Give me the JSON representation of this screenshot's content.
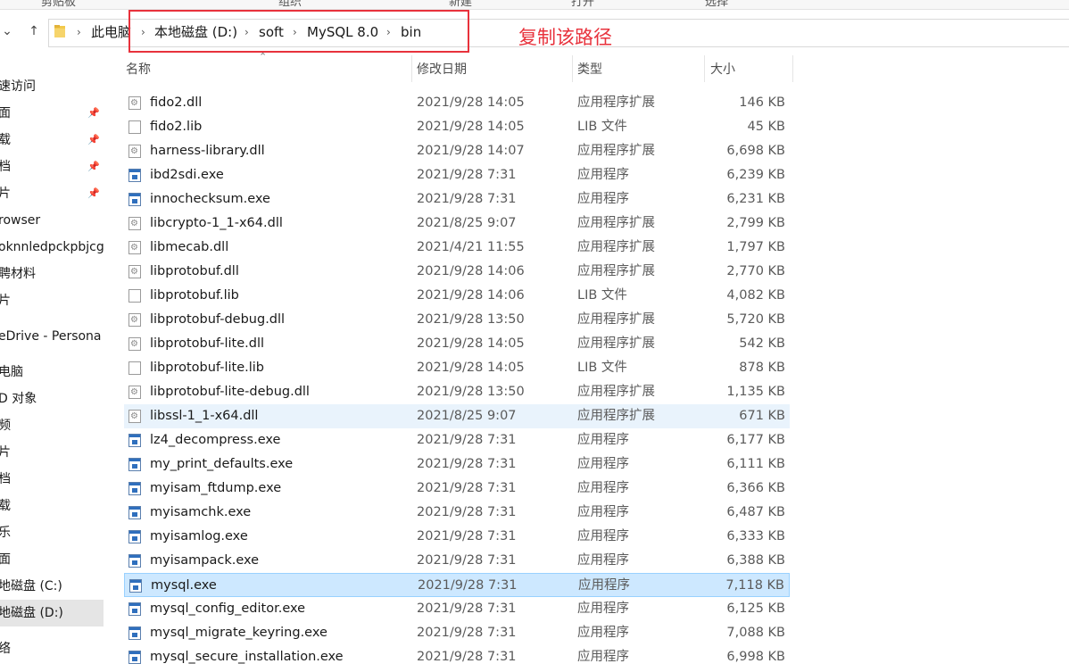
{
  "ribbon": {
    "items": [
      {
        "label": "剪贴板"
      },
      {
        "label": "组织"
      },
      {
        "label": "新建"
      },
      {
        "label": "打开"
      },
      {
        "label": "选择"
      }
    ]
  },
  "nav": {
    "back_glyph": "←",
    "forward_glyph": "→",
    "recent_glyph": "⌄",
    "up_glyph": "↑"
  },
  "address": {
    "crumbs": [
      {
        "label": "此电脑"
      },
      {
        "label": "本地磁盘 (D:)"
      },
      {
        "label": "soft"
      },
      {
        "label": "MySQL 8.0"
      },
      {
        "label": "bin"
      }
    ],
    "separator": "›"
  },
  "annotation": {
    "text": "复制该路径",
    "color": "#e8323c"
  },
  "sidebar": {
    "items": [
      {
        "label": "速访问"
      },
      {
        "label": "面",
        "pinned": true
      },
      {
        "label": "载",
        "pinned": true
      },
      {
        "label": "档",
        "pinned": true
      },
      {
        "label": "片",
        "pinned": true
      },
      {
        "label": "rowser"
      },
      {
        "label": "oknnledpckpbjcg"
      },
      {
        "label": "聘材料"
      },
      {
        "label": "片"
      },
      {
        "label": "eDrive - Persona"
      },
      {
        "label": "电脑"
      },
      {
        "label": "D 对象"
      },
      {
        "label": "频"
      },
      {
        "label": "片"
      },
      {
        "label": "档"
      },
      {
        "label": "载"
      },
      {
        "label": "乐"
      },
      {
        "label": "面"
      },
      {
        "label": "地磁盘 (C:)"
      },
      {
        "label": "地磁盘 (D:)",
        "selected": true
      },
      {
        "label": "络"
      }
    ],
    "pin_glyph": "📌"
  },
  "columns": {
    "name": "名称",
    "date": "修改日期",
    "type": "类型",
    "size": "大小"
  },
  "files": [
    {
      "name": "fido2.dll",
      "date": "2021/9/28 14:05",
      "type": "应用程序扩展",
      "size": "146 KB",
      "icon": "dll"
    },
    {
      "name": "fido2.lib",
      "date": "2021/9/28 14:05",
      "type": "LIB 文件",
      "size": "45 KB",
      "icon": "lib"
    },
    {
      "name": "harness-library.dll",
      "date": "2021/9/28 14:07",
      "type": "应用程序扩展",
      "size": "6,698 KB",
      "icon": "dll"
    },
    {
      "name": "ibd2sdi.exe",
      "date": "2021/9/28 7:31",
      "type": "应用程序",
      "size": "6,239 KB",
      "icon": "exe"
    },
    {
      "name": "innochecksum.exe",
      "date": "2021/9/28 7:31",
      "type": "应用程序",
      "size": "6,231 KB",
      "icon": "exe"
    },
    {
      "name": "libcrypto-1_1-x64.dll",
      "date": "2021/8/25 9:07",
      "type": "应用程序扩展",
      "size": "2,799 KB",
      "icon": "dll"
    },
    {
      "name": "libmecab.dll",
      "date": "2021/4/21 11:55",
      "type": "应用程序扩展",
      "size": "1,797 KB",
      "icon": "dll"
    },
    {
      "name": "libprotobuf.dll",
      "date": "2021/9/28 14:06",
      "type": "应用程序扩展",
      "size": "2,770 KB",
      "icon": "dll"
    },
    {
      "name": "libprotobuf.lib",
      "date": "2021/9/28 14:06",
      "type": "LIB 文件",
      "size": "4,082 KB",
      "icon": "lib"
    },
    {
      "name": "libprotobuf-debug.dll",
      "date": "2021/9/28 13:50",
      "type": "应用程序扩展",
      "size": "5,720 KB",
      "icon": "dll"
    },
    {
      "name": "libprotobuf-lite.dll",
      "date": "2021/9/28 14:05",
      "type": "应用程序扩展",
      "size": "542 KB",
      "icon": "dll"
    },
    {
      "name": "libprotobuf-lite.lib",
      "date": "2021/9/28 14:05",
      "type": "LIB 文件",
      "size": "878 KB",
      "icon": "lib"
    },
    {
      "name": "libprotobuf-lite-debug.dll",
      "date": "2021/9/28 13:50",
      "type": "应用程序扩展",
      "size": "1,135 KB",
      "icon": "dll"
    },
    {
      "name": "libssl-1_1-x64.dll",
      "date": "2021/8/25 9:07",
      "type": "应用程序扩展",
      "size": "671 KB",
      "icon": "dll",
      "state": "hover"
    },
    {
      "name": "lz4_decompress.exe",
      "date": "2021/9/28 7:31",
      "type": "应用程序",
      "size": "6,177 KB",
      "icon": "exe"
    },
    {
      "name": "my_print_defaults.exe",
      "date": "2021/9/28 7:31",
      "type": "应用程序",
      "size": "6,111 KB",
      "icon": "exe"
    },
    {
      "name": "myisam_ftdump.exe",
      "date": "2021/9/28 7:31",
      "type": "应用程序",
      "size": "6,366 KB",
      "icon": "exe"
    },
    {
      "name": "myisamchk.exe",
      "date": "2021/9/28 7:31",
      "type": "应用程序",
      "size": "6,487 KB",
      "icon": "exe"
    },
    {
      "name": "myisamlog.exe",
      "date": "2021/9/28 7:31",
      "type": "应用程序",
      "size": "6,333 KB",
      "icon": "exe"
    },
    {
      "name": "myisampack.exe",
      "date": "2021/9/28 7:31",
      "type": "应用程序",
      "size": "6,388 KB",
      "icon": "exe"
    },
    {
      "name": "mysql.exe",
      "date": "2021/9/28 7:31",
      "type": "应用程序",
      "size": "7,118 KB",
      "icon": "exe",
      "state": "selected"
    },
    {
      "name": "mysql_config_editor.exe",
      "date": "2021/9/28 7:31",
      "type": "应用程序",
      "size": "6,125 KB",
      "icon": "exe"
    },
    {
      "name": "mysql_migrate_keyring.exe",
      "date": "2021/9/28 7:31",
      "type": "应用程序",
      "size": "7,088 KB",
      "icon": "exe"
    },
    {
      "name": "mysql_secure_installation.exe",
      "date": "2021/9/28 7:31",
      "type": "应用程序",
      "size": "6,998 KB",
      "icon": "exe"
    }
  ]
}
